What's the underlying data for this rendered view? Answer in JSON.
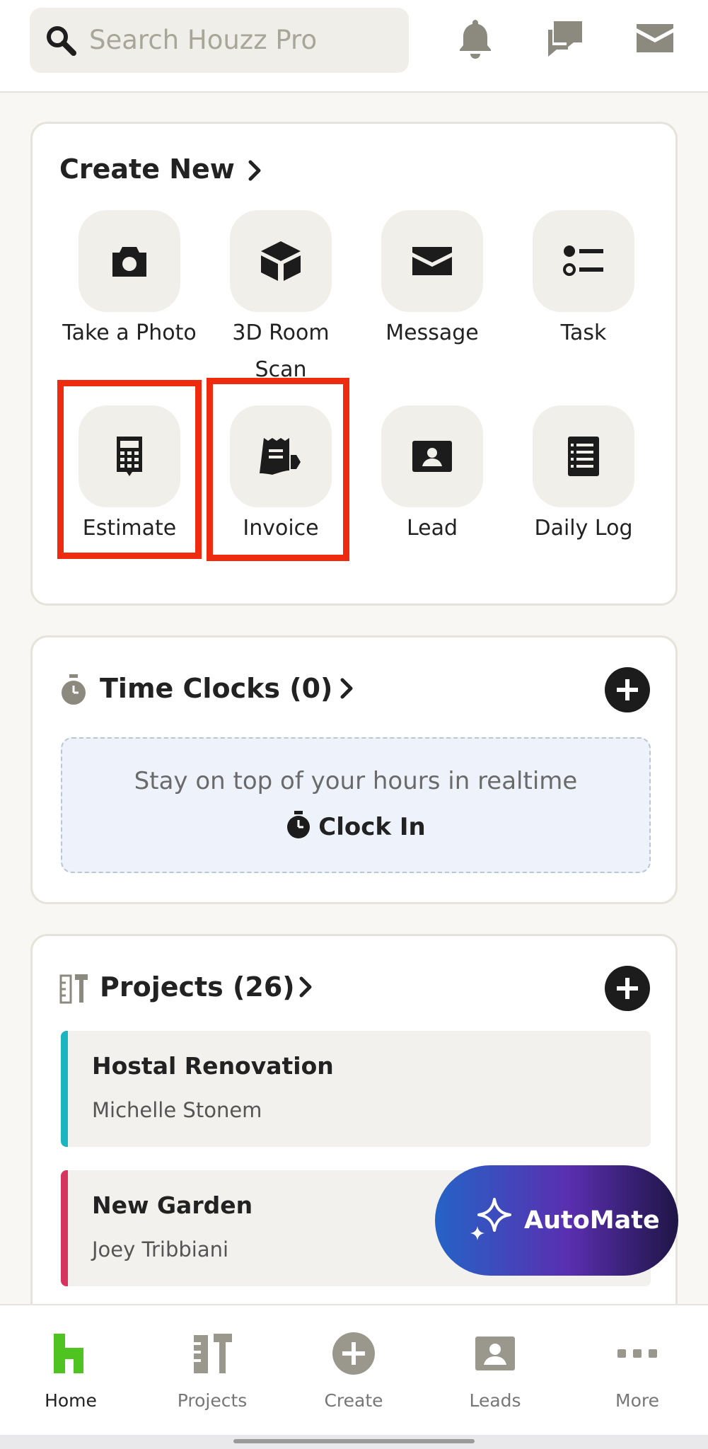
{
  "search": {
    "placeholder": "Search Houzz Pro"
  },
  "create_new": {
    "title": "Create New",
    "tiles": [
      {
        "label": "Take a Photo",
        "icon": "camera-icon"
      },
      {
        "label": "3D Room Scan",
        "icon": "cube-icon"
      },
      {
        "label": "Message",
        "icon": "envelope-icon"
      },
      {
        "label": "Task",
        "icon": "task-list-icon"
      },
      {
        "label": "Estimate",
        "icon": "calculator-icon"
      },
      {
        "label": "Invoice",
        "icon": "invoice-icon"
      },
      {
        "label": "Lead",
        "icon": "contact-card-icon"
      },
      {
        "label": "Daily Log",
        "icon": "notebook-icon"
      }
    ]
  },
  "time_clocks": {
    "title": "Time Clocks (0)",
    "message": "Stay on top of your hours in realtime",
    "clock_in": "Clock In"
  },
  "projects": {
    "title": "Projects (26)",
    "items": [
      {
        "name": "Hostal Renovation",
        "client": "Michelle Stonem",
        "color": "#1bb5c1"
      },
      {
        "name": "New Garden",
        "client": "Joey Tribbiani",
        "color": "#d6335f"
      }
    ]
  },
  "automate": {
    "label": "AutoMate"
  },
  "nav": {
    "items": [
      {
        "label": "Home",
        "icon": "home-icon",
        "active": true
      },
      {
        "label": "Projects",
        "icon": "projects-tools-icon"
      },
      {
        "label": "Create",
        "icon": "plus-circle-icon"
      },
      {
        "label": "Leads",
        "icon": "contact-card-icon"
      },
      {
        "label": "More",
        "icon": "more-dots-icon"
      }
    ]
  },
  "colors": {
    "accent_green": "#4fc420",
    "highlight_red": "#ef2b0f",
    "icon_gray": "#8c8a7e"
  }
}
